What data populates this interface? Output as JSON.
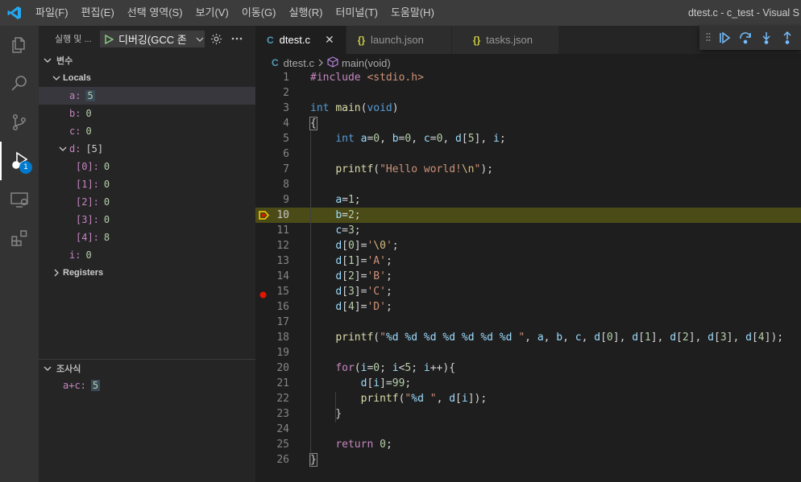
{
  "titlebar": {
    "menu": [
      "파일(F)",
      "편집(E)",
      "선택 영역(S)",
      "보기(V)",
      "이동(G)",
      "실행(R)",
      "터미널(T)",
      "도움말(H)"
    ],
    "window_title": "dtest.c - c_test - Visual S"
  },
  "activity": {
    "items": [
      {
        "name": "explorer-icon"
      },
      {
        "name": "search-icon"
      },
      {
        "name": "source-control-icon"
      },
      {
        "name": "run-debug-icon",
        "active": true,
        "badge": "1"
      },
      {
        "name": "remote-explorer-icon"
      },
      {
        "name": "extensions-icon"
      }
    ]
  },
  "sidebar": {
    "title": "실행 및 ...",
    "debug_config": "디버깅(GCC 존",
    "variables_header": "변수",
    "locals_label": "Locals",
    "locals": [
      {
        "name": "a:",
        "value": "5",
        "highlight": true
      },
      {
        "name": "b:",
        "value": "0"
      },
      {
        "name": "c:",
        "value": "0"
      },
      {
        "name": "d:",
        "value": "[5]",
        "expandable": true
      },
      {
        "name": "[0]:",
        "value": "0",
        "child": true
      },
      {
        "name": "[1]:",
        "value": "0",
        "child": true
      },
      {
        "name": "[2]:",
        "value": "0",
        "child": true
      },
      {
        "name": "[3]:",
        "value": "0",
        "child": true
      },
      {
        "name": "[4]:",
        "value": "8",
        "child": true
      },
      {
        "name": "i:",
        "value": "0"
      }
    ],
    "registers_label": "Registers",
    "watch_header": "조사식",
    "watch": [
      {
        "name": "a+c:",
        "value": "5"
      }
    ]
  },
  "tabs": [
    {
      "icon": "C",
      "label": "dtest.c",
      "active": true,
      "close": "✕"
    },
    {
      "icon": "{}",
      "label": "launch.json"
    },
    {
      "icon": "{}",
      "label": "tasks.json"
    }
  ],
  "breadcrumb": {
    "file": "dtest.c",
    "symbol": "main(void)"
  },
  "code": {
    "current_line": 10,
    "breakpoint_line": 15,
    "lines": [
      "1",
      "2",
      "3",
      "4",
      "5",
      "6",
      "7",
      "8",
      "9",
      "10",
      "11",
      "12",
      "13",
      "14",
      "15",
      "16",
      "17",
      "18",
      "19",
      "20",
      "21",
      "22",
      "23",
      "24",
      "25",
      "26"
    ]
  },
  "colors": {
    "accent": "#007acc",
    "current_line_bg": "#4b4b18",
    "breakpoint": "#e51400",
    "debug_arrow": "#ffcc00"
  }
}
